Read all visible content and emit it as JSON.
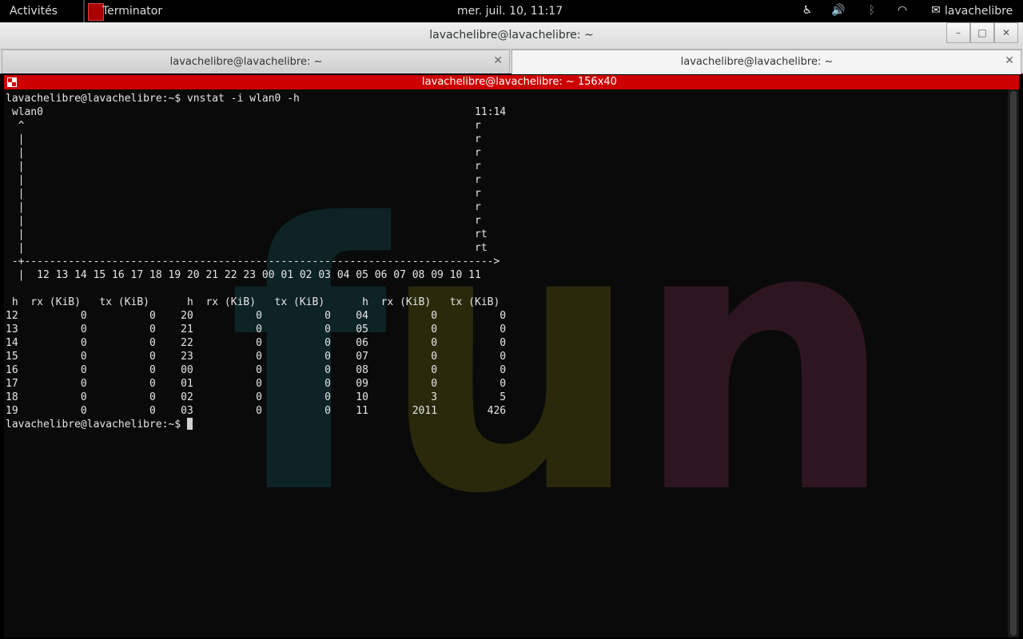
{
  "topbar": {
    "activities": "Activités",
    "app_name": "Terminator",
    "clock": "mer. juil. 10, 11:17",
    "user": "lavachelibre"
  },
  "window": {
    "title": "lavachelibre@lavachelibre: ~"
  },
  "tabs": [
    {
      "label": "lavachelibre@lavachelibre: ~"
    },
    {
      "label": "lavachelibre@lavachelibre: ~"
    }
  ],
  "terminal": {
    "title": "lavachelibre@lavachelibre: ~ 156x40",
    "wallpaper_text": [
      "f",
      "u",
      "n"
    ],
    "prompt": "lavachelibre@lavachelibre:~$ ",
    "lines": [
      "lavachelibre@lavachelibre:~$ vnstat -i wlan0 -h",
      " wlan0                                                                     11:14",
      "  ^                                                                        r",
      "  |                                                                        r",
      "  |                                                                        r",
      "  |                                                                        r",
      "  |                                                                        r",
      "  |                                                                        r",
      "  |                                                                        r",
      "  |                                                                        r",
      "  |                                                                        rt",
      "  |                                                                        rt",
      " -+--------------------------------------------------------------------------->",
      "  |  12 13 14 15 16 17 18 19 20 21 22 23 00 01 02 03 04 05 06 07 08 09 10 11",
      "",
      " h  rx (KiB)   tx (KiB)      h  rx (KiB)   tx (KiB)      h  rx (KiB)   tx (KiB)",
      "12          0          0    20          0          0    04          0          0",
      "13          0          0    21          0          0    05          0          0",
      "14          0          0    22          0          0    06          0          0",
      "15          0          0    23          0          0    07          0          0",
      "16          0          0    00          0          0    08          0          0",
      "17          0          0    01          0          0    09          0          0",
      "18          0          0    02          0          0    10          3          5",
      "19          0          0    03          0          0    11       2011        426"
    ]
  }
}
